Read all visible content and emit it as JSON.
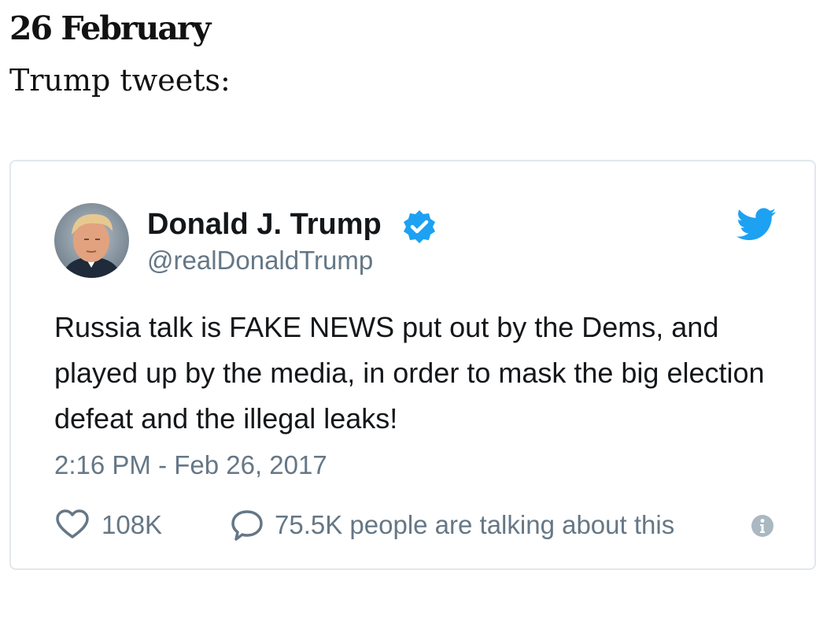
{
  "post": {
    "date_heading": "26 February",
    "intro": "Trump tweets:"
  },
  "tweet": {
    "author_name": "Donald J. Trump",
    "handle": "@realDonaldTrump",
    "verified": true,
    "text": "Russia talk is FAKE NEWS put out by the Dems, and played up by the media, in order to mask the big election defeat and the illegal leaks!",
    "timestamp": "2:16 PM - Feb 26, 2017",
    "likes": "108K",
    "talking": "75.5K people are talking about this"
  },
  "icons": {
    "avatar": "author-avatar",
    "verified": "verified-badge-icon",
    "brand": "twitter-bird-icon",
    "like": "heart-icon",
    "reply": "speech-bubble-icon",
    "info": "info-icon"
  },
  "colors": {
    "brand_blue": "#1da1f2",
    "text_primary": "#14171a",
    "text_secondary": "#657786",
    "card_border": "#e1e8ed",
    "info_gray": "#aab8c2"
  }
}
